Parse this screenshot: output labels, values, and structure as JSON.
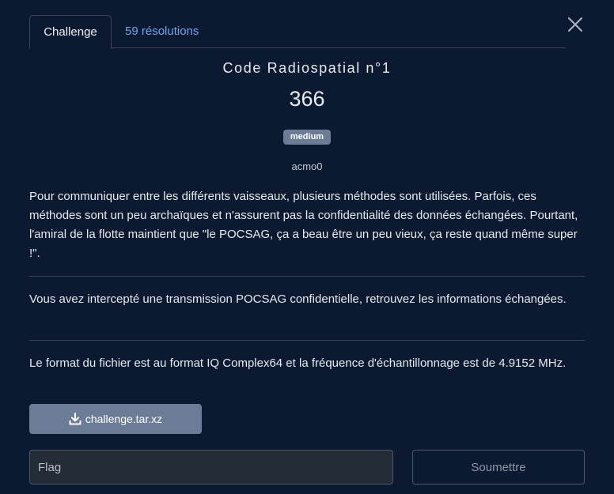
{
  "tabs": {
    "active_label": "Challenge",
    "solves_label": "59 résolutions"
  },
  "close_icon": "close-icon",
  "challenge": {
    "title": "Code Radiospatial n°1",
    "points": "366",
    "difficulty": "medium",
    "author": "acmo0"
  },
  "description": {
    "paragraph_1": "Pour communiquer entre les différents vaisseaux, plusieurs méthodes sont utilisées. Parfois, ces méthodes sont un peu archaïques et n'assurent pas la confidentialité des données échangées. Pourtant, l'amiral de la flotte maintient que \"le POCSAG, ça a beau être un peu vieux, ça reste quand même super !\".",
    "paragraph_2": "Vous avez intercepté une transmission POCSAG confidentielle, retrouvez les informations échangées.",
    "paragraph_3": "Le format du fichier est au format IQ Complex64 et la fréquence d'échantillonnage est de 4.9152 MHz."
  },
  "download": {
    "icon": "download-icon",
    "filename": "challenge.tar.xz"
  },
  "flag_input": {
    "placeholder": "Flag",
    "value": ""
  },
  "submit_label": "Soumettre",
  "colors": {
    "background": "#0b1a30",
    "link": "#6fa4f5",
    "badge": "#6c7c96",
    "divider": "#3a4658"
  }
}
